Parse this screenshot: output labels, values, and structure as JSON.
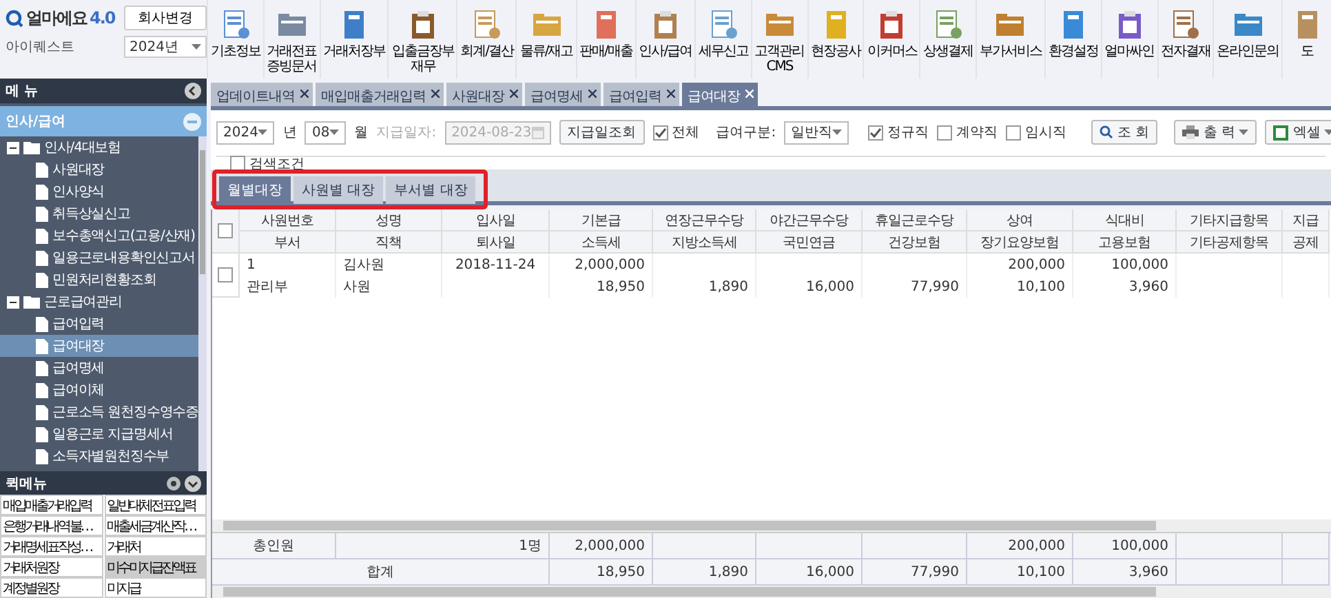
{
  "header": {
    "logo": {
      "name": "얼마에요",
      "version": "4.0"
    },
    "company_button": "회사변경",
    "company": "아이퀘스트",
    "year": "2024년"
  },
  "toolbar": [
    {
      "label": "기초정보"
    },
    {
      "label": "거래전표 증빙문서"
    },
    {
      "label": "거래처장부"
    },
    {
      "label": "입출금장부 재무"
    },
    {
      "label": "회계/결산"
    },
    {
      "label": "물류/재고"
    },
    {
      "label": "판매/매출"
    },
    {
      "label": "인사/급여"
    },
    {
      "label": "세무신고"
    },
    {
      "label": "고객관리 CMS"
    },
    {
      "label": "현장공사"
    },
    {
      "label": "이커머스"
    },
    {
      "label": "상생결제"
    },
    {
      "label": "부가서비스"
    },
    {
      "label": "환경설정"
    },
    {
      "label": "얼마싸인"
    },
    {
      "label": "전자결재"
    },
    {
      "label": "온라인문의"
    },
    {
      "label": "도"
    }
  ],
  "sidebar": {
    "title": "메 뉴",
    "section": "인사/급여",
    "tree": [
      {
        "label": "인사/4대보험",
        "expanded": true,
        "children": [
          {
            "label": "사원대장",
            "selected": false
          },
          {
            "label": "인사양식",
            "selected": false
          },
          {
            "label": "취득상실신고",
            "selected": false
          },
          {
            "label": "보수총액신고(고용/산재)",
            "selected": false
          },
          {
            "label": "일용근로내용확인신고서",
            "selected": false
          },
          {
            "label": "민원처리현황조회",
            "selected": false
          }
        ]
      },
      {
        "label": "근로급여관리",
        "expanded": true,
        "children": [
          {
            "label": "급여입력",
            "selected": false
          },
          {
            "label": "급여대장",
            "selected": true
          },
          {
            "label": "급여명세",
            "selected": false
          },
          {
            "label": "급여이체",
            "selected": false
          },
          {
            "label": "근로소득 원천징수영수증",
            "selected": false
          },
          {
            "label": "일용근로 지급명세서",
            "selected": false
          },
          {
            "label": "소득자별원천징수부",
            "selected": false
          }
        ]
      }
    ]
  },
  "quick_menu": {
    "title": "퀵메뉴",
    "items": [
      {
        "label": "매입매출거래입력",
        "selected": false
      },
      {
        "label": "일반대체전표입력",
        "selected": false
      },
      {
        "label": "은행 거래내역 불…",
        "selected": false
      },
      {
        "label": "매출세금계산 작…",
        "selected": false
      },
      {
        "label": "거래명세표 작성…",
        "selected": false
      },
      {
        "label": "거래처",
        "selected": false
      },
      {
        "label": "거래처원장",
        "selected": false
      },
      {
        "label": "미수미지급잔액표",
        "selected": true
      },
      {
        "label": "계정별원장",
        "selected": false
      },
      {
        "label": "미지급",
        "selected": false
      }
    ]
  },
  "tabs": [
    {
      "label": "업데이트내역",
      "selected": false
    },
    {
      "label": "매입매출거래입력",
      "selected": false
    },
    {
      "label": "사원대장",
      "selected": false
    },
    {
      "label": "급여명세",
      "selected": false
    },
    {
      "label": "급여입력",
      "selected": false
    },
    {
      "label": "급여대장",
      "selected": true
    }
  ],
  "filters": {
    "year": "2024",
    "year_unit": "년",
    "month": "08",
    "month_unit": "월",
    "pay_date_label": "지급일자:",
    "pay_date": "2024-08-23",
    "pay_date_button": "지급일조회",
    "all": {
      "label": "전체",
      "checked": true
    },
    "pay_type_label": "급여구분:",
    "pay_type": "일반직",
    "types": [
      {
        "label": "정규직",
        "checked": true
      },
      {
        "label": "계약직",
        "checked": false
      },
      {
        "label": "임시직",
        "checked": false
      }
    ],
    "search_button": "조 회",
    "print_button": "출 력",
    "excel_button": "엑셀",
    "search_conditions": {
      "label": "검색조건",
      "checked": false
    }
  },
  "sub_tabs": [
    {
      "label": "월별대장",
      "selected": true
    },
    {
      "label": "사원별 대장",
      "selected": false
    },
    {
      "label": "부서별 대장",
      "selected": false
    }
  ],
  "table": {
    "select_all": {
      "checked": false
    },
    "columns": [
      [
        "사원번호",
        "부서"
      ],
      [
        "성명",
        "직책"
      ],
      [
        "입사일",
        "퇴사일"
      ],
      [
        "기본급",
        "소득세"
      ],
      [
        "연장근무수당",
        "지방소득세"
      ],
      [
        "야간근무수당",
        "국민연금"
      ],
      [
        "휴일근로수당",
        "건강보험"
      ],
      [
        "상여",
        "장기요양보험"
      ],
      [
        "식대비",
        "고용보험"
      ],
      [
        "기타지급항목",
        "기타공제항목"
      ],
      [
        "지급",
        "공제"
      ]
    ],
    "rows": [
      {
        "checked": false,
        "employee_no": "1",
        "name": "김사원",
        "hire_date": "2018-11-24",
        "base_pay": "2,000,000",
        "bonus": "200,000",
        "meal": "100,000",
        "department": "관리부",
        "position": "사원",
        "income_tax": "18,950",
        "local_tax": "1,890",
        "pension": "16,000",
        "health": "77,990",
        "care": "10,100",
        "employment": "3,960"
      }
    ],
    "footer": {
      "total_label": "총인원",
      "total_count": "1명",
      "base_pay": "2,000,000",
      "bonus": "200,000",
      "meal": "100,000",
      "sum_label": "합계",
      "income_tax": "18,950",
      "local_tax": "1,890",
      "pension": "16,000",
      "health": "77,990",
      "care": "10,100",
      "employment": "3,960"
    }
  }
}
